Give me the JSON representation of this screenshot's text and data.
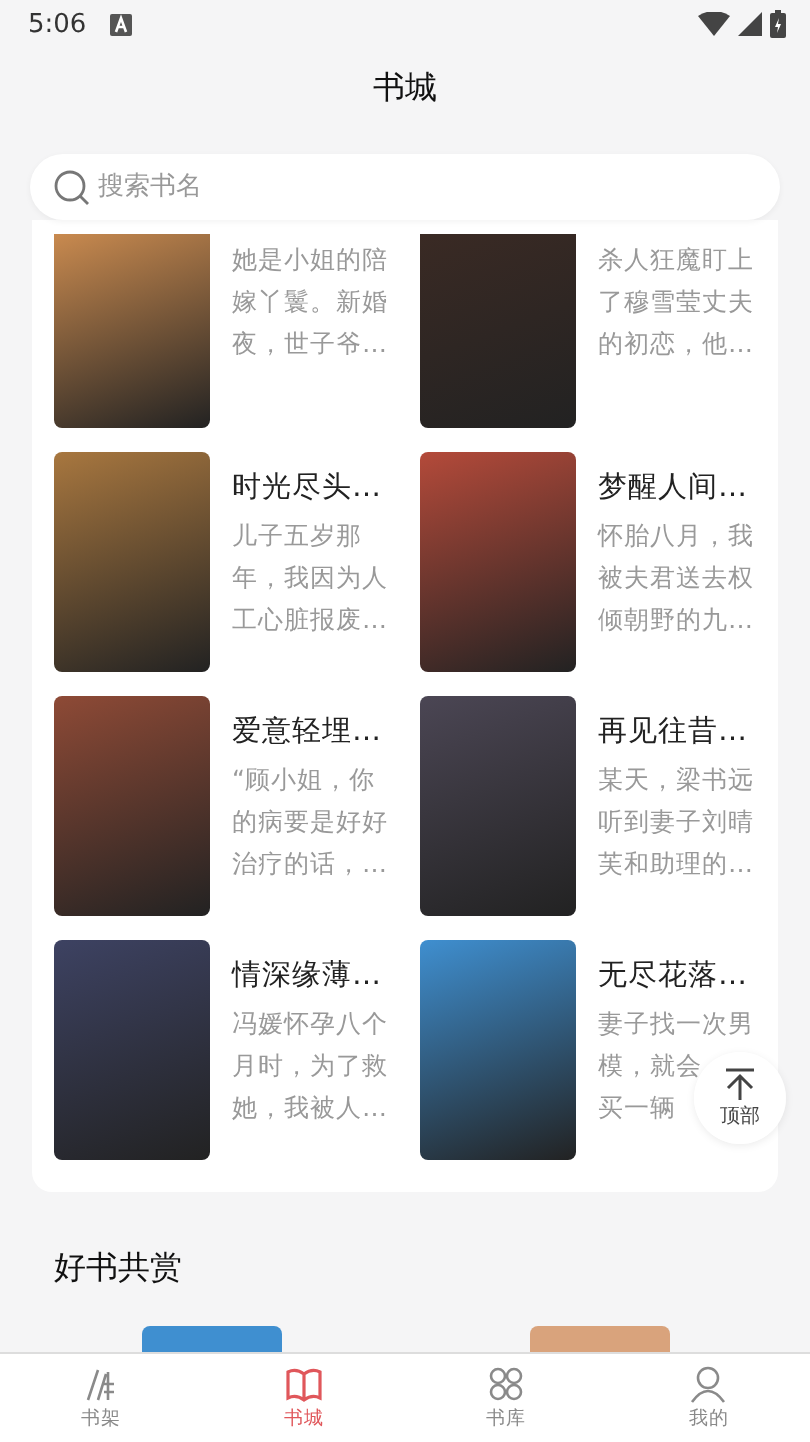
{
  "status_bar": {
    "time": "5:06"
  },
  "header": {
    "title": "书城"
  },
  "search": {
    "placeholder": "搜索书名"
  },
  "books": [
    {
      "description": "她是小姐的陪嫁丫鬟。新婚夜，世子爷…"
    },
    {
      "description": "杀人狂魔盯上了穆雪莹丈夫的初恋，他…"
    },
    {
      "title": "时光尽头…",
      "description": "儿子五岁那年，我因为人工心脏报废…"
    },
    {
      "title": "梦醒人间…",
      "description": "怀胎八月，我被夫君送去权倾朝野的九…"
    },
    {
      "title": "爱意轻埋…",
      "description": "“顾小姐，你的病要是好好治疗的话，…"
    },
    {
      "title": "再见往昔…",
      "description": "某天，梁书远听到妻子刘晴芙和助理的…"
    },
    {
      "title": "情深缘薄…",
      "description": "冯媛怀孕八个月时，为了救她，我被人…"
    },
    {
      "title": "无尽花落…",
      "description_lines": [
        "妻子找一次男",
        "模，就会",
        "买一辆"
      ]
    }
  ],
  "back_to_top": {
    "label": "顶部"
  },
  "section": {
    "title": "好书共赏"
  },
  "tabs": [
    {
      "label": "书架",
      "selected": false
    },
    {
      "label": "书城",
      "selected": true
    },
    {
      "label": "书库",
      "selected": false
    },
    {
      "label": "我的",
      "selected": false
    }
  ]
}
